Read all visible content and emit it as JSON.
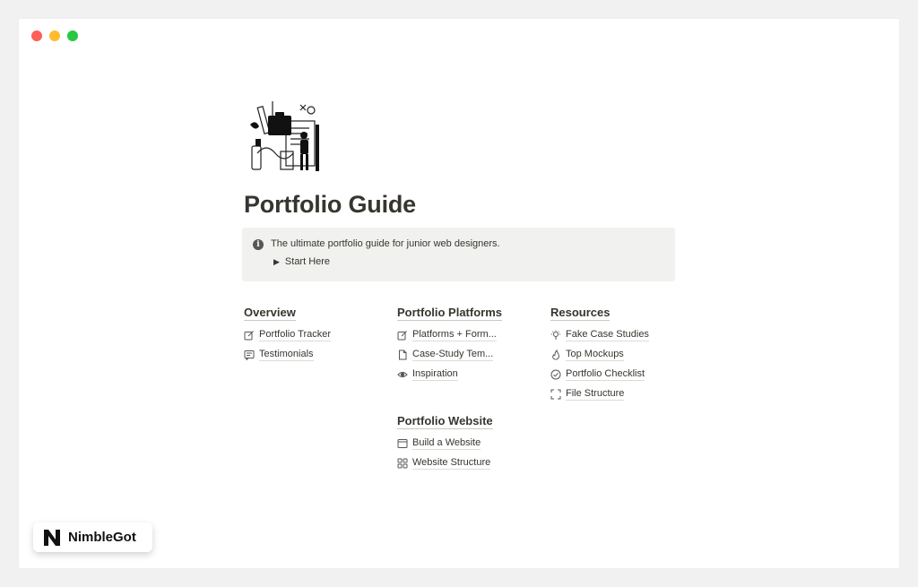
{
  "page": {
    "title": "Portfolio Guide",
    "callout": {
      "icon": "info-icon",
      "text": "The ultimate portfolio guide for junior web designers.",
      "toggle_label": "Start Here"
    }
  },
  "columns": [
    {
      "heading": "Overview",
      "links": [
        {
          "label": "Portfolio Tracker",
          "icon": "edit-icon"
        },
        {
          "label": "Testimonials",
          "icon": "message-icon"
        }
      ]
    },
    {
      "heading": "Portfolio Platforms",
      "links": [
        {
          "label": "Platforms + Form...",
          "icon": "edit-icon"
        },
        {
          "label": "Case-Study Tem...",
          "icon": "document-icon"
        },
        {
          "label": "Inspiration",
          "icon": "eye-icon"
        }
      ]
    },
    {
      "heading": "Resources",
      "links": [
        {
          "label": "Fake Case Studies",
          "icon": "lightbulb-icon"
        },
        {
          "label": "Top Mockups",
          "icon": "fire-icon"
        },
        {
          "label": "Portfolio Checklist",
          "icon": "check-circle-icon"
        },
        {
          "label": "File Structure",
          "icon": "frame-icon"
        }
      ]
    },
    {
      "heading": "Portfolio Website",
      "links": [
        {
          "label": "Build a Website",
          "icon": "browser-icon"
        },
        {
          "label": "Website Structure",
          "icon": "grid-icon"
        }
      ]
    }
  ],
  "brand": {
    "name": "NimbleGot"
  },
  "colors": {
    "text": "#37352f",
    "callout_bg": "#f1f1ef",
    "page_bg": "#ffffff",
    "backdrop": "#f1f1f1"
  }
}
